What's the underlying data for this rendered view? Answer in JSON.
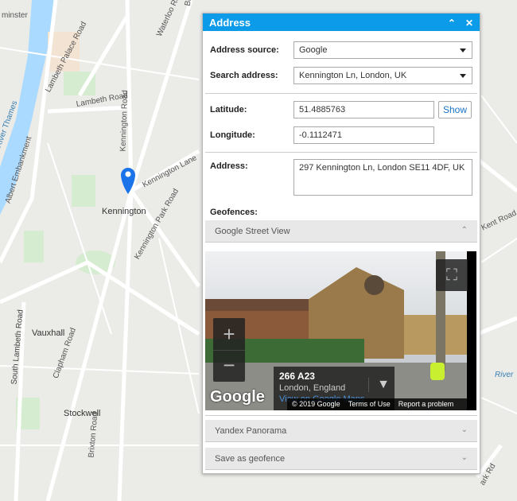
{
  "map": {
    "labels": [
      "minster",
      "Lambeth Palace Road",
      "Lambeth Road",
      "Waterloo Road",
      "River Thames",
      "Albert Embankment",
      "Kennington Road",
      "Kennington Lane",
      "Kennington",
      "Kennington Park Road",
      "Vauxhall",
      "South Lambeth Road",
      "Clapham Road",
      "Stockwell",
      "Brixton Road",
      "Kent Road",
      "River",
      "Bl",
      "ark Rd"
    ],
    "marker_color": "#1a73e8"
  },
  "panel": {
    "title": "Address",
    "collapse_icon": "double-chevron-up",
    "close_icon": "close",
    "address_source_label": "Address source:",
    "address_source_value": "Google",
    "search_address_label": "Search address:",
    "search_address_value": "Kennington Ln, London, UK",
    "latitude_label": "Latitude:",
    "latitude_value": "51.4885763",
    "show_label": "Show",
    "longitude_label": "Longitude:",
    "longitude_value": "-0.1112471",
    "address_label": "Address:",
    "address_value": "297 Kennington Ln, London SE11 4DF, UK",
    "geofences_label": "Geofences:",
    "sections": [
      "Google Street View",
      "Yandex Panorama",
      "Save as geofence"
    ]
  },
  "streetview": {
    "road": "266 A23",
    "place": "London, England",
    "link": "View on Google Maps",
    "logo": "Google",
    "copyright": "© 2019 Google",
    "terms": "Terms of Use",
    "report": "Report a problem"
  },
  "colors": {
    "header": "#0c9be8",
    "link": "#1a73c8"
  }
}
